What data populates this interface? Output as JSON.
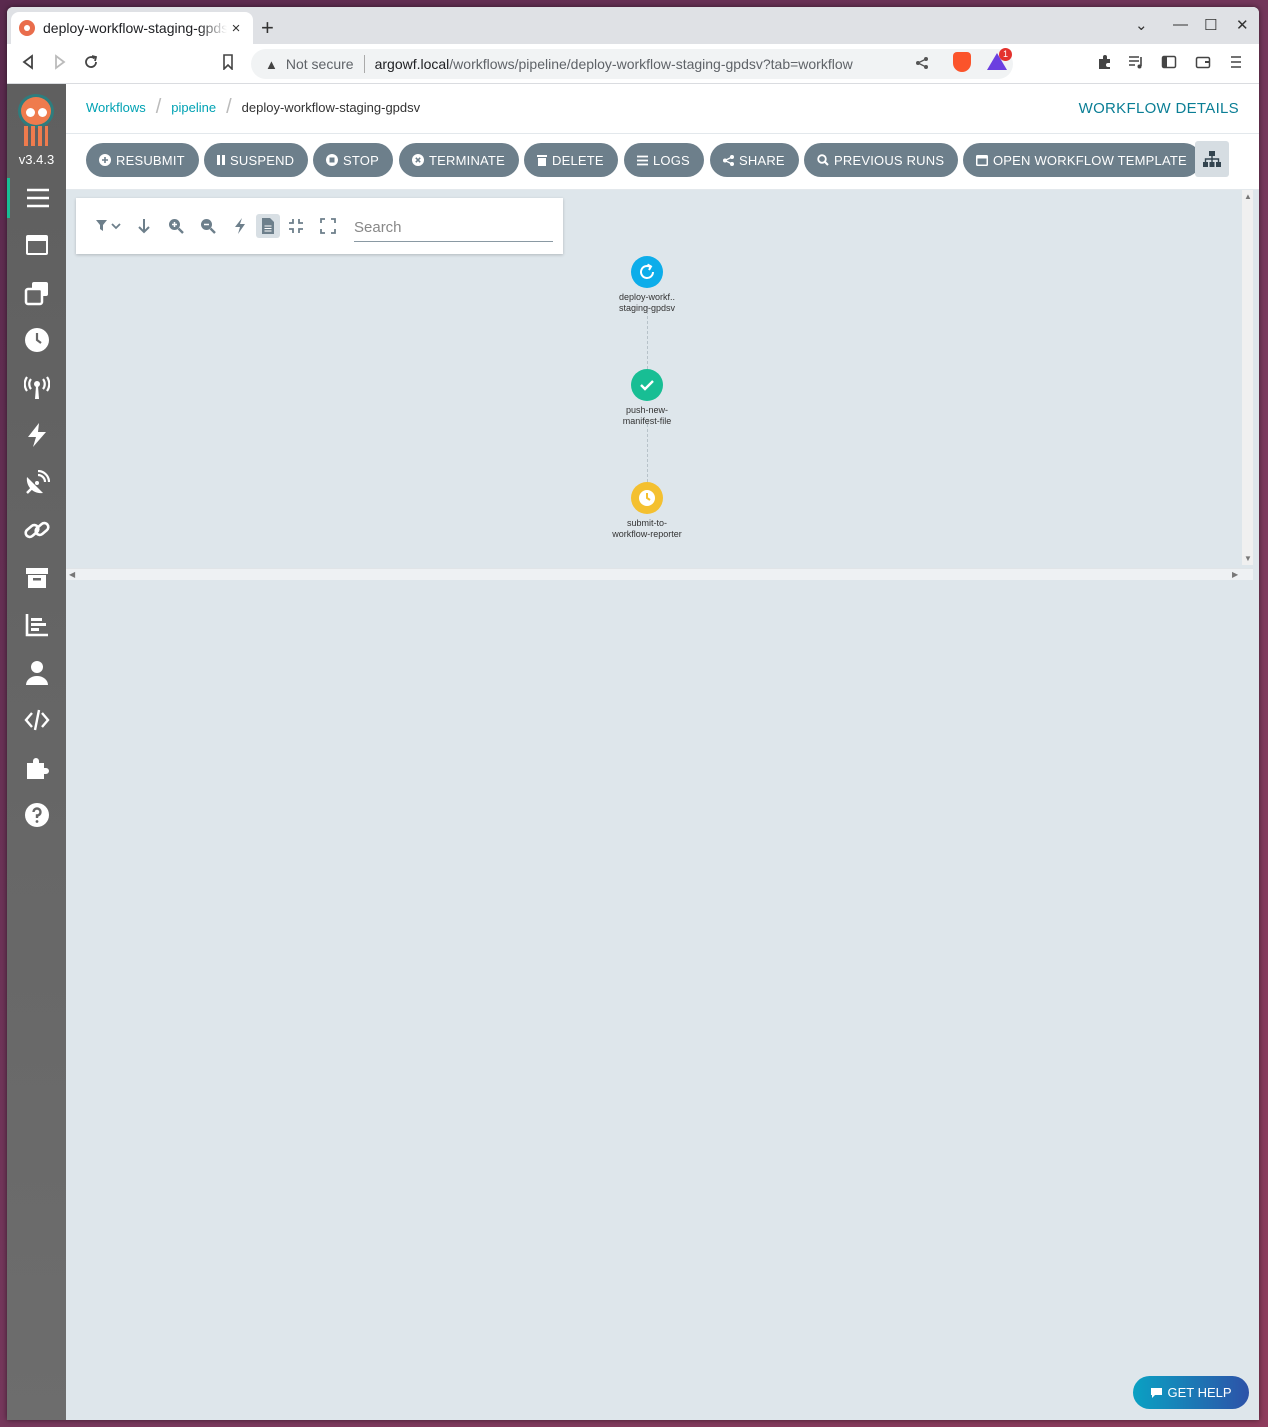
{
  "browser": {
    "tab_title": "deploy-workflow-staging-gpdsv",
    "tab_close": "×",
    "new_tab": "+",
    "security_label": "Not secure",
    "url_host": "argowf.local",
    "url_path": "/workflows/pipeline/deploy-workflow-staging-gpdsv?tab=workflow",
    "extension_badge": "1"
  },
  "sidebar": {
    "version": "v3.4.3",
    "items": [
      {
        "name": "workflows",
        "active": true
      },
      {
        "name": "workflow-templates"
      },
      {
        "name": "cluster-workflow-templates"
      },
      {
        "name": "cron-workflows"
      },
      {
        "name": "event-sources"
      },
      {
        "name": "sensors"
      },
      {
        "name": "event-flow"
      },
      {
        "name": "pipelines"
      },
      {
        "name": "archived-workflows"
      },
      {
        "name": "reports"
      },
      {
        "name": "user"
      },
      {
        "name": "api-docs"
      },
      {
        "name": "plugins"
      },
      {
        "name": "help"
      }
    ]
  },
  "breadcrumb": {
    "items": [
      "Workflows",
      "pipeline"
    ],
    "current": "deploy-workflow-staging-gpdsv"
  },
  "page_title": "WORKFLOW DETAILS",
  "actions": {
    "resubmit": "RESUBMIT",
    "suspend": "SUSPEND",
    "stop": "STOP",
    "terminate": "TERMINATE",
    "delete": "DELETE",
    "logs": "LOGS",
    "share": "SHARE",
    "previous_runs": "PREVIOUS RUNS",
    "open_template": "OPEN WORKFLOW TEMPLATE"
  },
  "graph": {
    "search_placeholder": "Search",
    "nodes": [
      {
        "label_line1": "deploy-workf..",
        "label_line2": "staging-gpdsv",
        "status": "running",
        "color": "#0dadea"
      },
      {
        "label_line1": "push-new-",
        "label_line2": "manifest-file",
        "status": "succeeded",
        "color": "#18be94"
      },
      {
        "label_line1": "submit-to-",
        "label_line2": "workflow-reporter",
        "status": "pending",
        "color": "#f4c030"
      }
    ]
  },
  "help_button": "GET HELP"
}
